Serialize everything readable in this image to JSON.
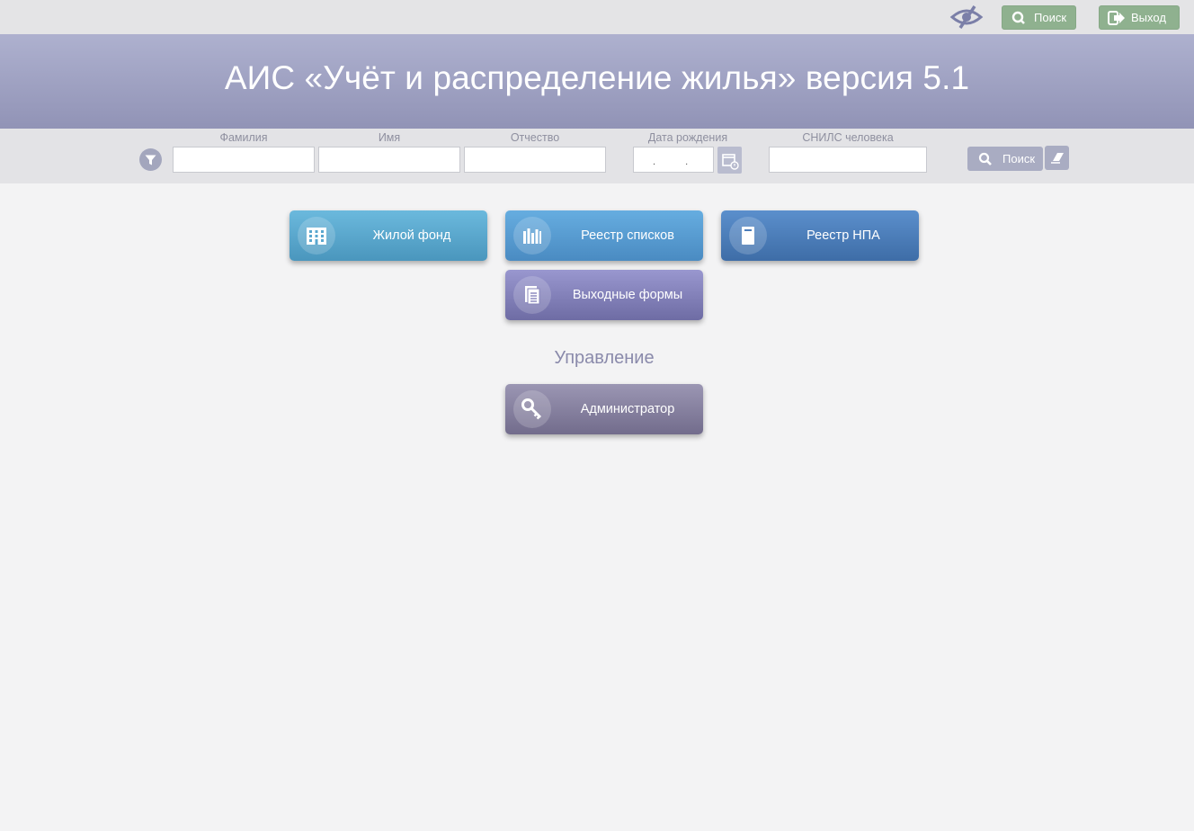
{
  "topbar": {
    "accessibility_icon": "eye-slash-icon",
    "search_label": "Поиск",
    "exit_label": "Выход",
    "accent_color": "#8fb18f"
  },
  "header": {
    "title": "АИС «Учёт и распределение жилья» версия 5.1"
  },
  "search": {
    "fields": {
      "lastname": "Фамилия",
      "firstname": "Имя",
      "patronymic": "Отчество",
      "birthdate": "Дата рождения",
      "snils": "СНИЛС человека"
    },
    "date_placeholder": ". .",
    "search_label": "Поиск"
  },
  "tiles": {
    "housing": "Жилой фонд",
    "registry_lists": "Реестр списков",
    "registry_npa": "Реестр НПА",
    "output_forms": "Выходные формы",
    "admin": "Администратор"
  },
  "section": {
    "management": "Управление"
  }
}
